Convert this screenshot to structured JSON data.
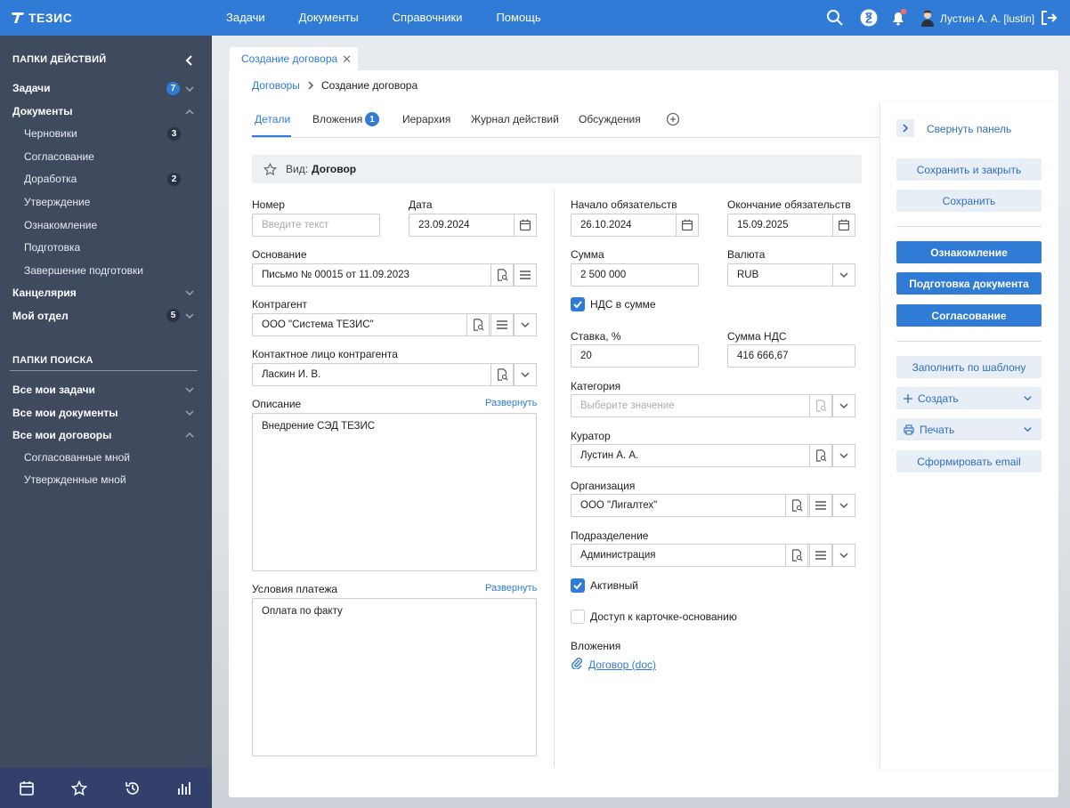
{
  "app": {
    "logo": "ТЕЗИС"
  },
  "topnav": [
    "Задачи",
    "Документы",
    "Справочники",
    "Помощь"
  ],
  "user": {
    "name": "Лустин А. А. [lustin]"
  },
  "sidebar": {
    "actions_header": "ПАПКИ ДЕЙСТВИЙ",
    "tasks": {
      "label": "Задачи",
      "badge": "7"
    },
    "documents": {
      "label": "Документы"
    },
    "doc_subs": [
      {
        "label": "Черновики",
        "badge": "3"
      },
      {
        "label": "Согласование",
        "badge": ""
      },
      {
        "label": "Доработка",
        "badge": "2"
      },
      {
        "label": "Утверждение",
        "badge": ""
      },
      {
        "label": "Ознакомление",
        "badge": ""
      },
      {
        "label": "Подготовка",
        "badge": ""
      },
      {
        "label": "Завершение подготовки",
        "badge": ""
      }
    ],
    "office": {
      "label": "Канцелярия"
    },
    "my_dept": {
      "label": "Мой отдел",
      "badge": "5"
    },
    "search_header": "ПАПКИ ПОИСКА",
    "search_items": [
      "Все мои задачи",
      "Все мои документы",
      "Все мои договоры"
    ],
    "contract_subs": [
      "Согласованные мной",
      "Утвержденные мной"
    ]
  },
  "doc_tab": {
    "label": "Создание договора"
  },
  "breadcrumb": {
    "parent": "Договоры",
    "current": "Создание договора"
  },
  "tabs": [
    {
      "label": "Детали"
    },
    {
      "label": "Вложения",
      "badge": "1"
    },
    {
      "label": "Иерархия"
    },
    {
      "label": "Журнал действий"
    },
    {
      "label": "Обсуждения"
    }
  ],
  "kind": {
    "label": "Вид:",
    "value": "Договор"
  },
  "form": {
    "number": {
      "label": "Номер",
      "placeholder": "Введите текст"
    },
    "date": {
      "label": "Дата",
      "value": "23.09.2024"
    },
    "basis": {
      "label": "Основание",
      "value": "Письмо № 00015 от 11.09.2023"
    },
    "contractor": {
      "label": "Контрагент",
      "value": "ООО \"Система ТЕЗИС\""
    },
    "contact": {
      "label": "Контактное лицо контрагента",
      "value": "Ласкин И. В."
    },
    "description": {
      "label": "Описание",
      "expand": "Развернуть",
      "value": "Внедрение СЭД ТЕЗИС"
    },
    "payment": {
      "label": "Условия платежа",
      "expand": "Развернуть",
      "value": "Оплата по факту"
    },
    "start": {
      "label": "Начало обязательств",
      "value": "26.10.2024"
    },
    "end": {
      "label": "Окончание обязательств",
      "value": "15.09.2025"
    },
    "sum": {
      "label": "Сумма",
      "value": "2 500 000"
    },
    "currency": {
      "label": "Валюта",
      "value": "RUB"
    },
    "vat_included": {
      "label": "НДС в сумме",
      "checked": true
    },
    "rate": {
      "label": "Ставка, %",
      "value": "20"
    },
    "vat_sum": {
      "label": "Сумма НДС",
      "value": "416 666,67"
    },
    "category": {
      "label": "Категория",
      "placeholder": "Выберите значение"
    },
    "curator": {
      "label": "Куратор",
      "value": "Лустин А. А."
    },
    "organization": {
      "label": "Организация",
      "value": "ООО \"Лигалтех\""
    },
    "department": {
      "label": "Подразделение",
      "value": "Администрация"
    },
    "active": {
      "label": "Активный",
      "checked": true
    },
    "basis_access": {
      "label": "Доступ к карточке-основанию",
      "checked": false
    },
    "attachments": {
      "label": "Вложения",
      "file": "Договор (doc)"
    }
  },
  "right_panel": {
    "collapse": "Свернуть панель",
    "save_close": "Сохранить и закрыть",
    "save": "Сохранить",
    "familiarize": "Ознакомление",
    "prepare": "Подготовка документа",
    "approve": "Согласование",
    "fill_template": "Заполнить по шаблону",
    "create": "Создать",
    "print": "Печать",
    "email": "Сформировать email"
  },
  "colors": {
    "accent": "#2f7bd6",
    "sidebar": "#3f4a5f",
    "sidebar_bottom": "#33406b"
  }
}
